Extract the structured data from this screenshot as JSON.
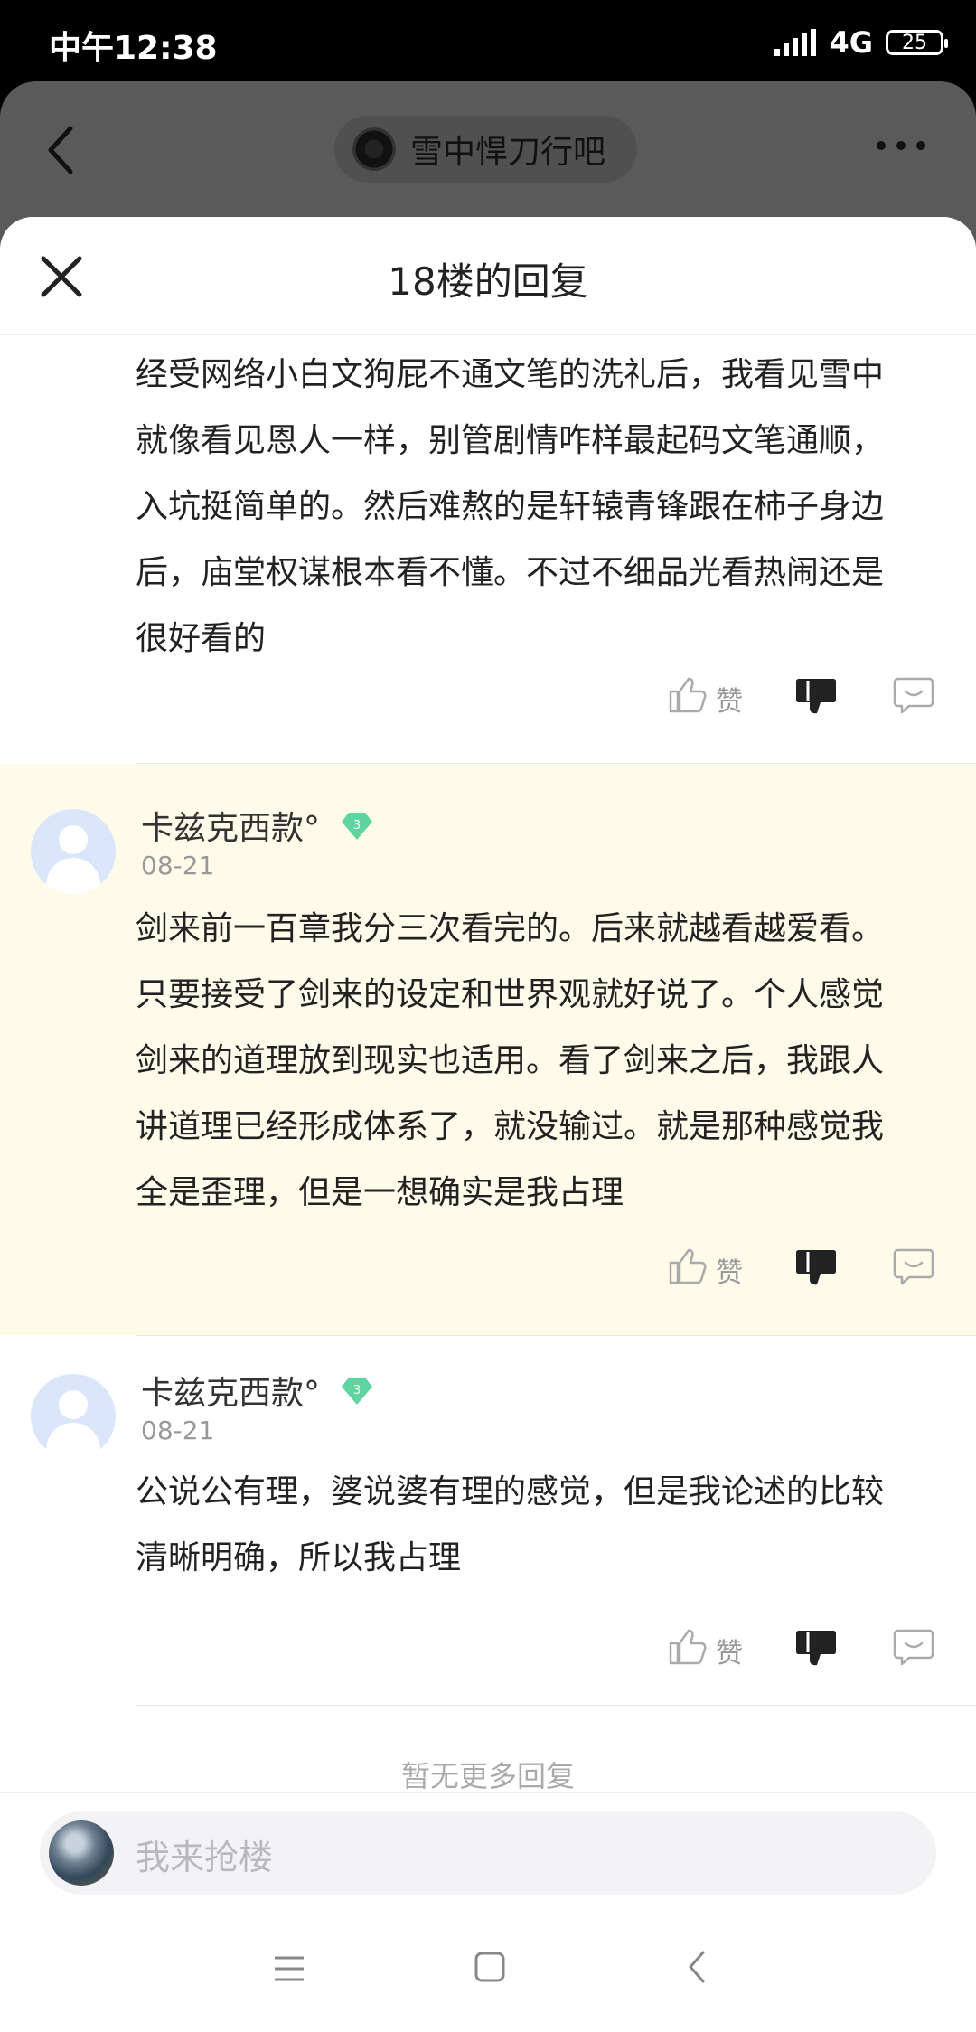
{
  "status_bar": {
    "time": "中午12:38",
    "network": "4G",
    "battery": "25"
  },
  "background_header": {
    "forum_name": "雪中悍刀行吧"
  },
  "sheet": {
    "title": "18楼的回复"
  },
  "top_reply": {
    "text_lines": [
      "经受网络小白文狗屁不通文笔的洗礼后，我看见雪中",
      "就像看见恩人一样，别管剧情咋样最起码文笔通顺，",
      "入坑挺简单的。然后难熬的是轩辕青锋跟在柿子身边",
      "后，庙堂权谋根本看不懂。不过不细品光看热闹还是",
      "很好看的"
    ],
    "like_label": "赞"
  },
  "replies": [
    {
      "username": "卡兹克西款°",
      "level": "3",
      "date": "08-21",
      "text_lines": [
        "剑来前一百章我分三次看完的。后来就越看越爱看。",
        "只要接受了剑来的设定和世界观就好说了。个人感觉",
        "剑来的道理放到现实也适用。看了剑来之后，我跟人",
        "讲道理已经形成体系了，就没输过。就是那种感觉我",
        "全是歪理，但是一想确实是我占理"
      ],
      "like_label": "赞"
    },
    {
      "username": "卡兹克西款°",
      "level": "3",
      "date": "08-21",
      "text_lines": [
        "公说公有理，婆说婆有理的感觉，但是我论述的比较",
        "清晰明确，所以我占理"
      ],
      "like_label": "赞"
    }
  ],
  "no_more": "暂无更多回复",
  "input": {
    "placeholder": "我来抢楼"
  },
  "colors": {
    "highlight_bg": "#fffbeb",
    "badge": "#5fd3a0",
    "text": "#222222",
    "muted": "#999999"
  }
}
